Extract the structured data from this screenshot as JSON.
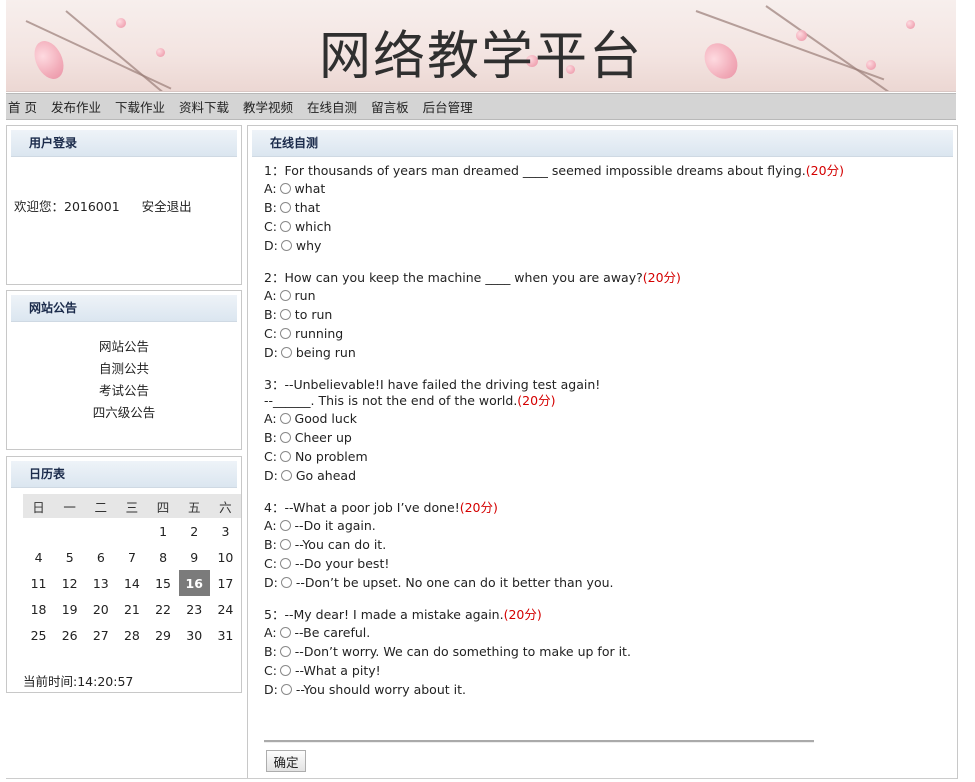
{
  "header": {
    "title": "网络教学平台"
  },
  "nav": [
    "首 页",
    "发布作业",
    "下载作业",
    "资料下载",
    "教学视频",
    "在线自测",
    "留言板",
    "后台管理"
  ],
  "login": {
    "heading": "用户登录",
    "welcome": "欢迎您：2016001",
    "logout": "安全退出"
  },
  "notice": {
    "heading": "网站公告",
    "items": [
      "网站公告",
      "自测公共",
      "考试公告",
      "四六级公告"
    ]
  },
  "calendar": {
    "heading": "日历表",
    "weekdays": [
      "日",
      "一",
      "二",
      "三",
      "四",
      "五",
      "六"
    ],
    "weeks": [
      [
        "",
        "",
        "",
        "",
        "1",
        "2",
        "3"
      ],
      [
        "4",
        "5",
        "6",
        "7",
        "8",
        "9",
        "10"
      ],
      [
        "11",
        "12",
        "13",
        "14",
        "15",
        "16",
        "17"
      ],
      [
        "18",
        "19",
        "20",
        "21",
        "22",
        "23",
        "24"
      ],
      [
        "25",
        "26",
        "27",
        "28",
        "29",
        "30",
        "31"
      ]
    ],
    "today": "16",
    "current_time": "当前时间:14:20:57"
  },
  "quiz": {
    "heading": "在线自测",
    "questions": [
      {
        "text": "1：For thousands of years man dreamed ____ seemed impossible dreams about flying.",
        "score": "(20分)",
        "options": [
          [
            "A:",
            "what"
          ],
          [
            "B:",
            "that"
          ],
          [
            "C:",
            "which"
          ],
          [
            "D:",
            "why"
          ]
        ]
      },
      {
        "text": "2：How can you keep the machine ____ when you are away?",
        "score": "(20分)",
        "options": [
          [
            "A:",
            "run"
          ],
          [
            "B:",
            "to run"
          ],
          [
            "C:",
            "running"
          ],
          [
            "D:",
            "being run"
          ]
        ]
      },
      {
        "text": "3：--Unbelievable!I have failed the driving test again!",
        "text2": "--______. This is not the end of the world.",
        "score": "(20分)",
        "options": [
          [
            "A:",
            "Good luck"
          ],
          [
            "B:",
            "Cheer up"
          ],
          [
            "C:",
            "No problem"
          ],
          [
            "D:",
            "Go ahead"
          ]
        ]
      },
      {
        "text": "4：--What a poor job I’ve done!",
        "score": "(20分)",
        "options": [
          [
            "A:",
            "--Do it again."
          ],
          [
            "B:",
            "--You can do it."
          ],
          [
            "C:",
            "--Do your best!"
          ],
          [
            "D:",
            "--Don’t be upset. No one can do it better than you."
          ]
        ]
      },
      {
        "text": "5：--My dear! I made a mistake again.",
        "score": "(20分)",
        "options": [
          [
            "A:",
            "--Be careful."
          ],
          [
            "B:",
            "--Don’t worry. We can do something to make up for it."
          ],
          [
            "C:",
            "--What a pity!"
          ],
          [
            "D:",
            "--You should worry about it."
          ]
        ]
      }
    ],
    "submit": "确定"
  },
  "colors": {
    "score": "#d40000",
    "nav_bg": "#d4d4d4",
    "panel_head": "#dbe6f0",
    "today_bg": "#7b7b7b"
  }
}
